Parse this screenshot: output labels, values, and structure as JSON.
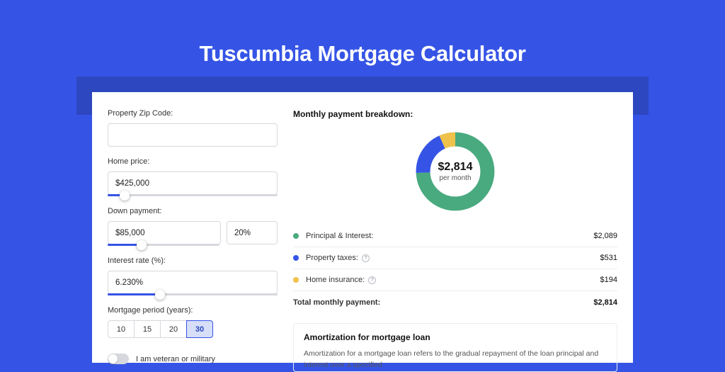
{
  "title": "Tuscumbia Mortgage Calculator",
  "form": {
    "zip_label": "Property Zip Code:",
    "zip_value": "",
    "home_price_label": "Home price:",
    "home_price_value": "$425,000",
    "home_price_slider_pct": 10,
    "down_label": "Down payment:",
    "down_value": "$85,000",
    "down_pct_value": "20%",
    "down_slider_pct": 20,
    "rate_label": "Interest rate (%):",
    "rate_value": "6.230%",
    "rate_slider_pct": 31,
    "period_label": "Mortgage period (years):",
    "period_options": [
      "10",
      "15",
      "20",
      "30"
    ],
    "period_selected": "30",
    "veteran_label": "I am veteran or military"
  },
  "breakdown": {
    "title": "Monthly payment breakdown:",
    "center_amount": "$2,814",
    "center_sub": "per month",
    "items": [
      {
        "label": "Principal & Interest:",
        "value": "$2,089",
        "color": "#49aa7f",
        "info": false
      },
      {
        "label": "Property taxes:",
        "value": "$531",
        "color": "#3554e6",
        "info": true
      },
      {
        "label": "Home insurance:",
        "value": "$194",
        "color": "#eec24b",
        "info": true
      }
    ],
    "total_label": "Total monthly payment:",
    "total_value": "$2,814"
  },
  "chart_data": {
    "type": "pie",
    "title": "Monthly payment breakdown",
    "series": [
      {
        "name": "Principal & Interest",
        "value": 2089,
        "color": "#49aa7f"
      },
      {
        "name": "Property taxes",
        "value": 531,
        "color": "#3554e6"
      },
      {
        "name": "Home insurance",
        "value": 194,
        "color": "#eec24b"
      }
    ],
    "total": 2814
  },
  "amort": {
    "title": "Amortization for mortgage loan",
    "text": "Amortization for a mortgage loan refers to the gradual repayment of the loan principal and interest over a specified"
  }
}
